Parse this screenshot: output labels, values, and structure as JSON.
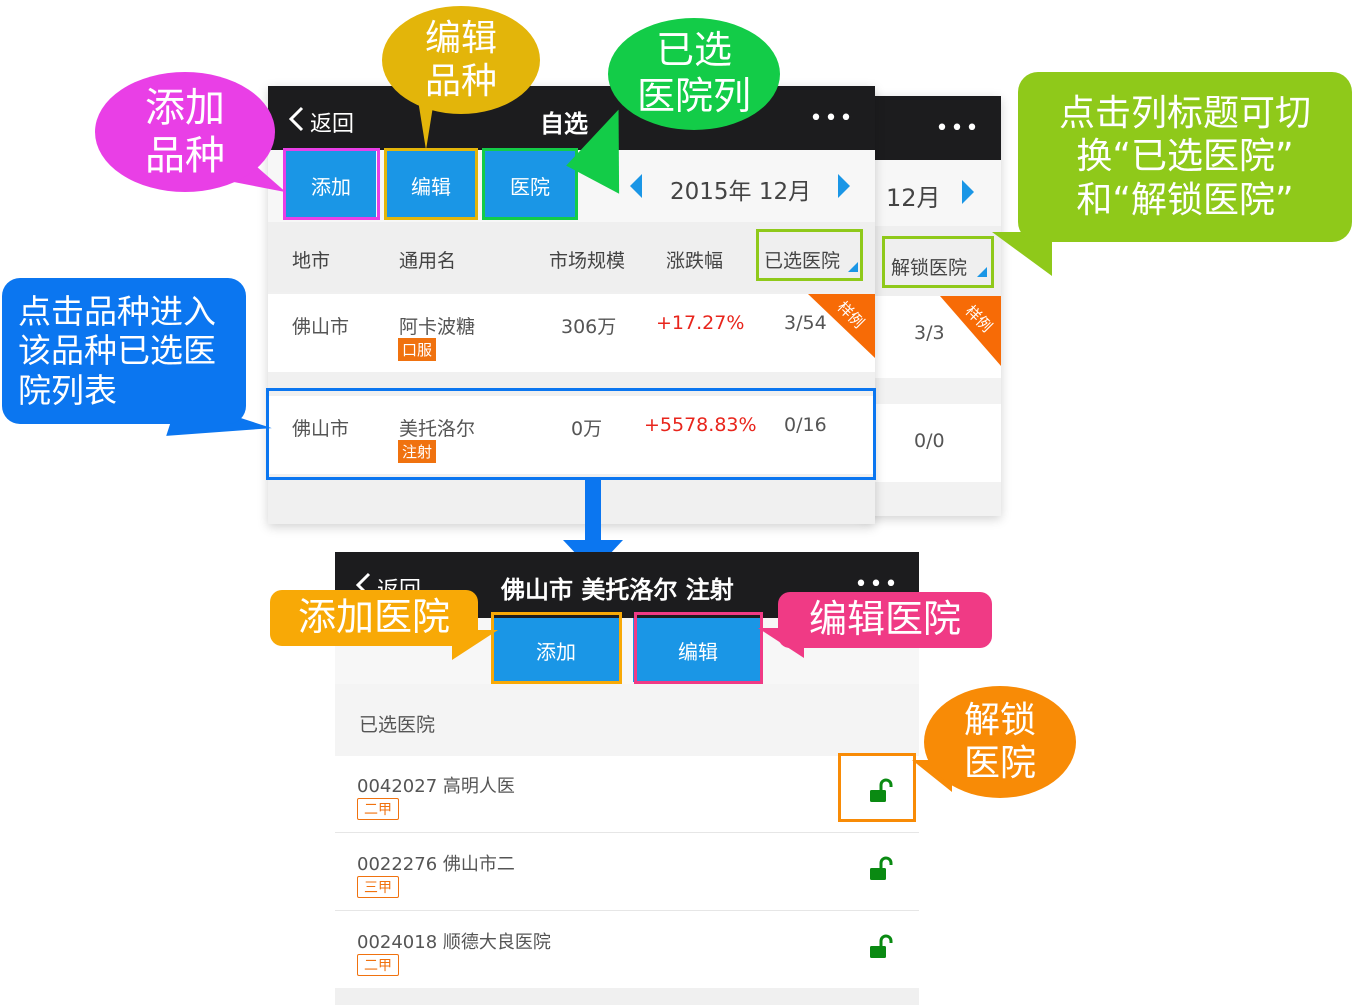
{
  "screen1": {
    "back_label": "返回",
    "title": "自选",
    "more": "•••",
    "buttons": {
      "add": "添加",
      "edit": "编辑",
      "hospital": "医院"
    },
    "date": "2015年 12月",
    "columns": [
      "地市",
      "通用名",
      "市场规模",
      "涨跌幅",
      "已选医院"
    ],
    "rows": [
      {
        "city": "佛山市",
        "name": "阿卡波糖",
        "tag": "口服",
        "market": "306万",
        "change": "+17.27%",
        "selected": "3/54",
        "ribbon": "样例"
      },
      {
        "city": "佛山市",
        "name": "美托洛尔",
        "tag": "注射",
        "market": "0万",
        "change": "+5578.83%",
        "selected": "0/16"
      }
    ]
  },
  "screen2": {
    "more": "•••",
    "date": "12月",
    "column": "解锁医院",
    "rows": [
      {
        "unlocked": "3/3",
        "ribbon": "样例"
      },
      {
        "unlocked": "0/0"
      }
    ]
  },
  "screen3": {
    "back_label": "返回",
    "title": "佛山市 美托洛尔 注射",
    "more": "•••",
    "buttons": {
      "add": "添加",
      "edit": "编辑"
    },
    "section_title": "已选医院",
    "hospitals": [
      {
        "name": "0042027 高明人医",
        "grade": "二甲"
      },
      {
        "name": "0022276 佛山市二",
        "grade": "三甲"
      },
      {
        "name": "0024018 顺德大良医院",
        "grade": "二甲"
      }
    ]
  },
  "callouts": {
    "add_variety": [
      "添加",
      "品种"
    ],
    "edit_variety": [
      "编辑",
      "品种"
    ],
    "selected_hospital_col": [
      "已选",
      "医院列"
    ],
    "toggle_hint": [
      "点击列标题可切",
      "换“已选医院”",
      "和“解锁医院”"
    ],
    "click_variety": [
      "点击品种进入",
      "该品种已选医",
      "院列表"
    ],
    "add_hospital": "添加医院",
    "edit_hospital": "编辑医院",
    "unlock_hospital": [
      "解锁",
      "医院"
    ]
  },
  "colors": {
    "nav_bg": "#1c1c1e",
    "button_blue": "#1a96e6",
    "magenta": "#e93fe6",
    "gold": "#e3b50a",
    "green": "#13cc48",
    "lime": "#8fc91a",
    "blue": "#0b76f0",
    "orange": "#f88b06",
    "pink": "#f03a85",
    "red_text": "#e8251c",
    "tag_orange": "#f0720f",
    "lock_green": "#0a8a12"
  }
}
